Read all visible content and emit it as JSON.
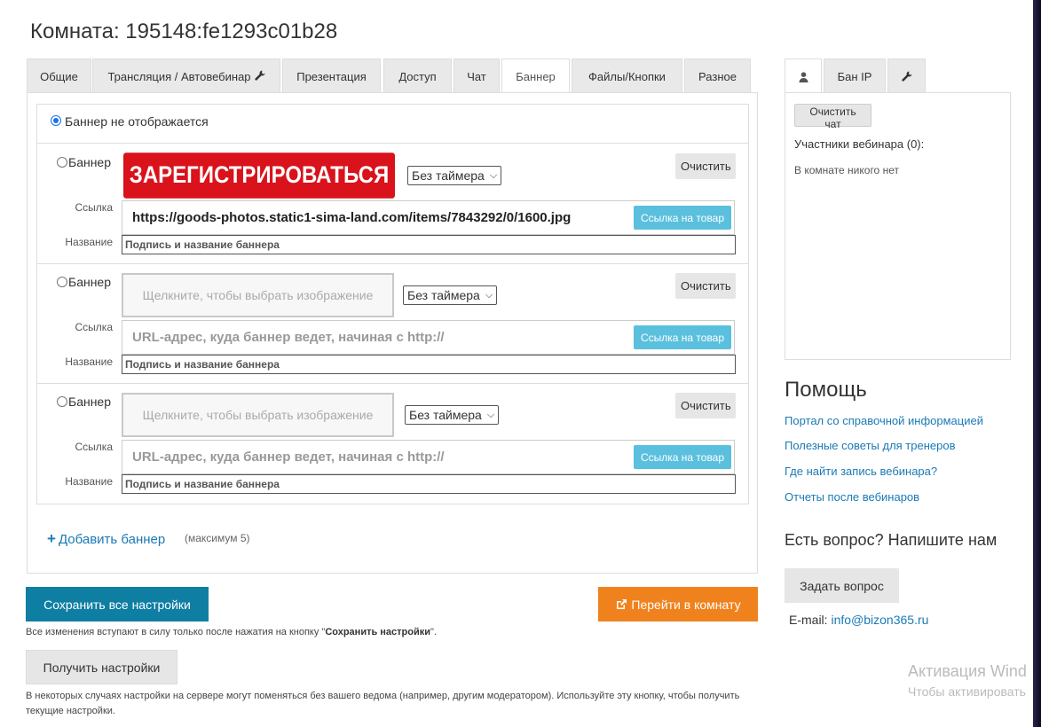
{
  "page": {
    "title": "Комната: 195148:fe1293c01b28"
  },
  "tabs": [
    {
      "label": "Общие"
    },
    {
      "label": "Трансляция / Автовебинар"
    },
    {
      "label": "Презентация"
    },
    {
      "label": "Доступ"
    },
    {
      "label": "Чат"
    },
    {
      "label": "Баннер",
      "active": true
    },
    {
      "label": "Файлы/Кнопки"
    },
    {
      "label": "Разное"
    }
  ],
  "banner_tab": {
    "no_banner_label": "Баннер не отображается",
    "banners": [
      {
        "label": "Баннер",
        "image_text": "ЗАРЕГИСТРИРОВАТЬСЯ",
        "image_placeholder": "",
        "timer": "Без таймера",
        "clear_label": "Очистить",
        "link_label": "Ссылка",
        "link_value": "https://goods-photos.static1-sima-land.com/items/7843292/0/1600.jpg",
        "link_placeholder": "",
        "product_button": "Ссылка на товар",
        "name_label": "Название",
        "name_placeholder": "Подпись и название баннера"
      },
      {
        "label": "Баннер",
        "image_text": "",
        "image_placeholder": "Щелкните, чтобы выбрать изображение",
        "timer": "Без таймера",
        "clear_label": "Очистить",
        "link_label": "Ссылка",
        "link_value": "",
        "link_placeholder": "URL-адрес, куда баннер ведет, начиная с http://",
        "product_button": "Ссылка на товар",
        "name_label": "Название",
        "name_placeholder": "Подпись и название баннера"
      },
      {
        "label": "Баннер",
        "image_text": "",
        "image_placeholder": "Щелкните, чтобы выбрать изображение",
        "timer": "Без таймера",
        "clear_label": "Очистить",
        "link_label": "Ссылка",
        "link_value": "",
        "link_placeholder": "URL-адрес, куда баннер ведет, начиная с http://",
        "product_button": "Ссылка на товар",
        "name_label": "Название",
        "name_placeholder": "Подпись и название баннера"
      }
    ],
    "add_banner": "Добавить баннер",
    "add_max": "(максимум 5)"
  },
  "actions": {
    "save_all": "Сохранить все настройки",
    "goto_room": "Перейти в комнату",
    "note_prefix": "Все изменения вступают в силу только после нажатия на кнопку \"",
    "note_bold": "Сохранить настройки",
    "note_suffix": "\".",
    "get_settings": "Получить настройки",
    "note2": "В некоторых случаях настройки на сервере могут поменяться без вашего ведома (например, другим модератором). Используйте эту кнопку, чтобы получить текущие настройки."
  },
  "right_tabs": [
    {
      "label": "",
      "icon": "user-icon",
      "active": true
    },
    {
      "label": "Бан IP"
    },
    {
      "label": "",
      "icon": "wrench-icon"
    }
  ],
  "chat_panel": {
    "clear_chat": "Очистить чат",
    "participants": "Участники вебинара (0):",
    "nobody": "В комнате никого нет"
  },
  "help": {
    "title": "Помощь",
    "links": [
      "Портал со справочной информацией",
      "Полезные советы для тренеров",
      "Где найти запись вебинара?",
      "Отчеты после вебинаров"
    ],
    "ask_title": "Есть вопрос? Напишите нам",
    "ask_button": "Задать вопрос",
    "email_label": "E-mail:",
    "email": "info@bizon365.ru"
  },
  "os_overlay": {
    "line1": "Активация Wind",
    "line2": "Чтобы активировать"
  },
  "colors": {
    "save_button": "#0f7ea3",
    "goto_button": "#f0821e",
    "product_button": "#5bc0de",
    "banner_red": "#d9121b",
    "link": "#1a7ab5"
  }
}
